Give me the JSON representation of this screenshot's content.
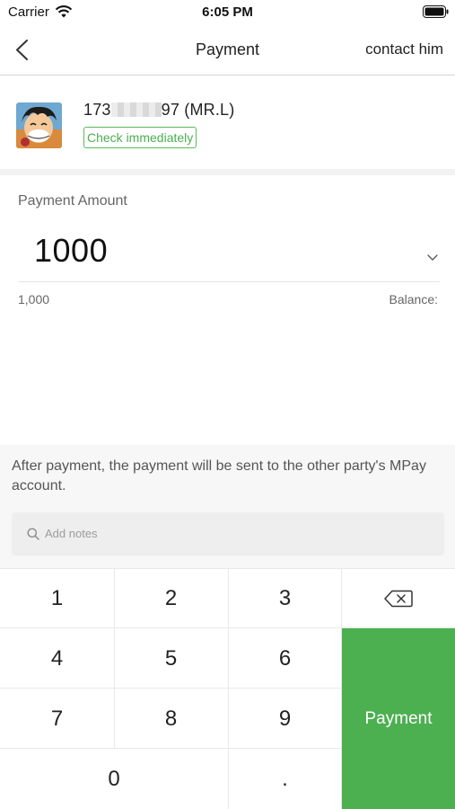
{
  "status_bar": {
    "carrier": "Carrier",
    "time": "6:05 PM"
  },
  "nav": {
    "title": "Payment",
    "contact": "contact him",
    "back_icon": "chevron-left-icon"
  },
  "payee": {
    "name_prefix": "173",
    "name_suffix": "97 (MR.L)",
    "check_label": "Check immediately",
    "badge_color": "#4caf50"
  },
  "amount": {
    "label": "Payment Amount",
    "value": "1000",
    "formatted": "1,000",
    "balance_label": "Balance:"
  },
  "notice": "After payment, the payment will be sent to the other party's MPay account.",
  "notes": {
    "placeholder": "Add notes"
  },
  "keypad": {
    "keys": [
      "1",
      "2",
      "3",
      "4",
      "5",
      "6",
      "7",
      "8",
      "9",
      "0",
      "."
    ],
    "pay_label": "Payment",
    "pay_color": "#4caf50",
    "delete_icon": "backspace-icon"
  }
}
